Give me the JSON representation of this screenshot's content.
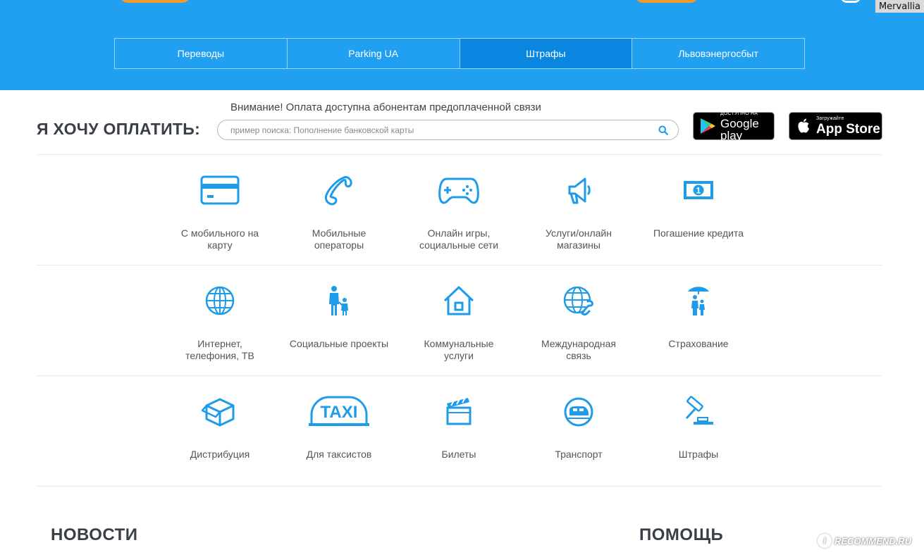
{
  "header": {
    "user_name": "Mervallia",
    "tabs": [
      {
        "label": "Переводы",
        "active": false
      },
      {
        "label": "Parking UA",
        "active": false
      },
      {
        "label": "Штрафы",
        "active": true
      },
      {
        "label": "Львовэнергосбыт",
        "active": false
      }
    ]
  },
  "pay": {
    "title": "Я ХОЧУ ОПЛАТИТЬ:",
    "notice": "Внимание! Оплата доступна абонентам предоплаченной связи",
    "search_placeholder": "пример поиска: Пополнение банковской карты"
  },
  "stores": {
    "google_small": "ДОСТУПНО НА",
    "google_big": "Google play",
    "apple_small": "Загружайте",
    "apple_big": "App Store"
  },
  "categories": [
    {
      "label": "С мобильного на\nкарту",
      "icon": "credit-card-icon"
    },
    {
      "label": "Мобильные\nоператоры",
      "icon": "phone-icon"
    },
    {
      "label": "Онлайн игры,\nсоциальные сети",
      "icon": "gamepad-icon"
    },
    {
      "label": "Услуги/онлайн\nмагазины",
      "icon": "megaphone-icon"
    },
    {
      "label": "Погашение кредита",
      "icon": "banknote-icon"
    },
    {
      "label": "Интернет,\nтелефония, ТВ",
      "icon": "globe-icon"
    },
    {
      "label": "Социальные проекты",
      "icon": "family-icon"
    },
    {
      "label": "Коммунальные\nуслуги",
      "icon": "house-icon"
    },
    {
      "label": "Международная\nсвязь",
      "icon": "globe-phone-icon"
    },
    {
      "label": "Страхование",
      "icon": "umbrella-family-icon"
    },
    {
      "label": "Дистрибуция",
      "icon": "box-icon"
    },
    {
      "label": "Для таксистов",
      "icon": "taxi-icon",
      "icon_text": "TAXI"
    },
    {
      "label": "Билеты",
      "icon": "clapperboard-icon"
    },
    {
      "label": "Транспорт",
      "icon": "train-icon"
    },
    {
      "label": "Штрафы",
      "icon": "gavel-icon"
    }
  ],
  "sections": {
    "news": "НОВОСТИ",
    "help": "ПОМОЩЬ"
  },
  "watermark": "RECOMMEND.RU",
  "colors": {
    "brand_blue": "#21a0f2",
    "active_tab": "#0a86e0",
    "icon_blue": "#1e9be9",
    "accent_orange": "#f29a2e"
  }
}
